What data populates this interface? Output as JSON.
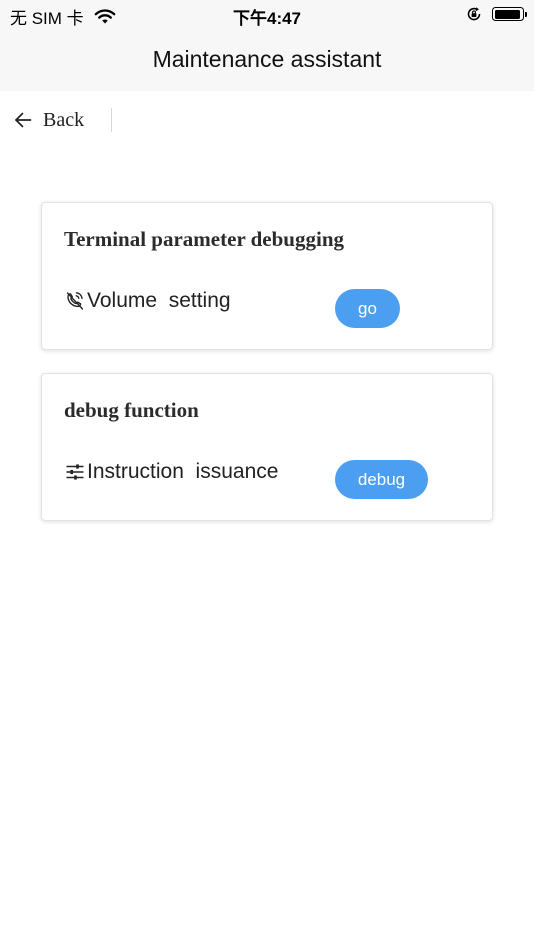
{
  "status_bar": {
    "carrier": "无 SIM 卡",
    "time": "下午4:47",
    "icons": [
      "wifi-icon",
      "rotation-lock-icon",
      "battery-icon"
    ]
  },
  "header": {
    "title": "Maintenance assistant"
  },
  "nav": {
    "back_label": "Back",
    "back_icon": "arrow-left-icon"
  },
  "cards": [
    {
      "title": "Terminal parameter debugging",
      "item_icon": "phone-volume-icon",
      "item_label": "Volume  setting",
      "button_label": "go"
    },
    {
      "title": "debug function",
      "item_icon": "sliders-icon",
      "item_label": "Instruction  issuance",
      "button_label": "debug"
    }
  ],
  "colors": {
    "accent": "#4c9ff0",
    "header_bg": "#f7f7f7",
    "card_border": "#e3e3e3"
  }
}
